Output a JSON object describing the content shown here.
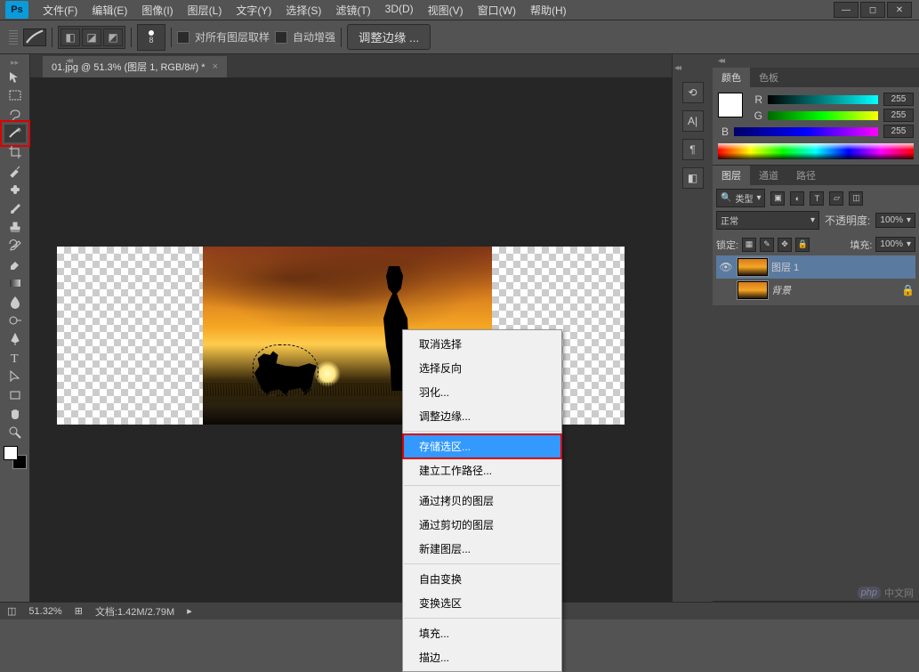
{
  "menu": {
    "file": "文件(F)",
    "edit": "编辑(E)",
    "image": "图像(I)",
    "layer": "图层(L)",
    "type": "文字(Y)",
    "select": "选择(S)",
    "filter": "滤镜(T)",
    "threeD": "3D(D)",
    "view": "视图(V)",
    "window": "窗口(W)",
    "help": "帮助(H)"
  },
  "options": {
    "sample_all": "对所有图层取样",
    "auto_enhance": "自动增强",
    "refine_edge": "调整边缘 ...",
    "brush_size": "8"
  },
  "doc": {
    "tab_title": "01.jpg @ 51.3% (图层 1, RGB/8#) *"
  },
  "context_menu": {
    "deselect": "取消选择",
    "inverse": "选择反向",
    "feather": "羽化...",
    "refine": "调整边缘...",
    "save_selection": "存储选区...",
    "make_path": "建立工作路径...",
    "layer_copy": "通过拷贝的图层",
    "layer_cut": "通过剪切的图层",
    "new_layer": "新建图层...",
    "free_transform": "自由变换",
    "transform_sel": "变换选区",
    "fill": "填充...",
    "stroke": "描边..."
  },
  "panels": {
    "color_tab": "颜色",
    "swatches_tab": "色板",
    "r_label": "R",
    "g_label": "G",
    "b_label": "B",
    "r_val": "255",
    "g_val": "255",
    "b_val": "255",
    "layers_tab": "图层",
    "channels_tab": "通道",
    "paths_tab": "路径",
    "kind_label": "类型",
    "blend_mode": "正常",
    "opacity_label": "不透明度:",
    "opacity_val": "100%",
    "lock_label": "锁定:",
    "fill_label": "填充:",
    "fill_val": "100%",
    "layer1_name": "图层 1",
    "bg_name": "背景"
  },
  "status": {
    "zoom": "51.32%",
    "doc_label": "文档:",
    "doc_size": "1.42M/2.79M"
  },
  "watermark": {
    "php": "php",
    "cn": "中文网"
  }
}
